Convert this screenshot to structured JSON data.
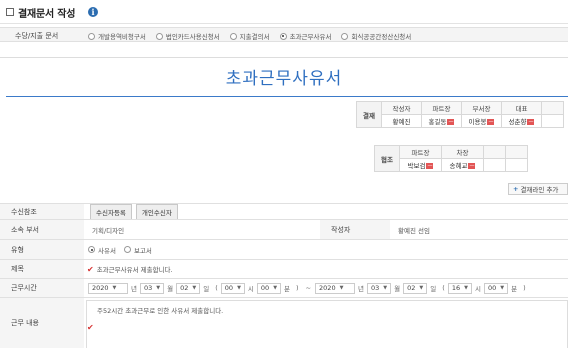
{
  "header": {
    "title": "결재문서 작성",
    "info_icon": "i"
  },
  "doc_types": {
    "label": "수당/지출 문서",
    "options": [
      {
        "label": "개발용역비청구서",
        "selected": false
      },
      {
        "label": "법인카드사용신청서",
        "selected": false
      },
      {
        "label": "지출결의서",
        "selected": false
      },
      {
        "label": "초과근무사유서",
        "selected": true
      },
      {
        "label": "회식공공간정산신청서",
        "selected": false
      }
    ]
  },
  "document": {
    "title": "초과근무사유서",
    "approval": {
      "side_label": "결재",
      "headers": [
        "작성자",
        "파트장",
        "부서장",
        "대표"
      ],
      "names": [
        "황예진",
        "홍길동",
        "이용봉",
        "성춘향"
      ],
      "removable": [
        false,
        true,
        true,
        true
      ]
    },
    "cooperation": {
      "side_label": "협조",
      "headers": [
        "파트장",
        "차장"
      ],
      "names": [
        "박보검",
        "송혜교"
      ],
      "removable": [
        true,
        true
      ]
    },
    "add_line_label": "결재라인 추가"
  },
  "form": {
    "receivers": {
      "label": "수신참조",
      "buttons": [
        "수신자등록",
        "개인수신자"
      ]
    },
    "department": {
      "label": "소속 부서",
      "value": "기획/디자인",
      "author_label": "작성자",
      "author_value": "황예진 선임"
    },
    "type": {
      "label": "유형",
      "options": [
        {
          "label": "사유서",
          "selected": true
        },
        {
          "label": "보고서",
          "selected": false
        }
      ]
    },
    "subject": {
      "label": "제목",
      "value": "초과근무사유서 제출합니다."
    },
    "time": {
      "label": "근무시간",
      "start": {
        "year": "2020",
        "month": "03",
        "day": "02",
        "hour": "00",
        "minute": "00"
      },
      "end": {
        "year": "2020",
        "month": "03",
        "day": "02",
        "hour": "16",
        "minute": "00"
      },
      "units": {
        "year": "년",
        "month": "월",
        "day": "일",
        "hour": "시",
        "minute": "분"
      },
      "open_paren": "(",
      "close_paren": ")",
      "tilde": "~"
    },
    "content": {
      "label": "근무 내용",
      "value": "주52시간 초과근무로 인한 사유서 제출합니다."
    }
  },
  "colors": {
    "accent": "#2f6fc0",
    "remove": "#e25555",
    "check": "#d63232"
  }
}
